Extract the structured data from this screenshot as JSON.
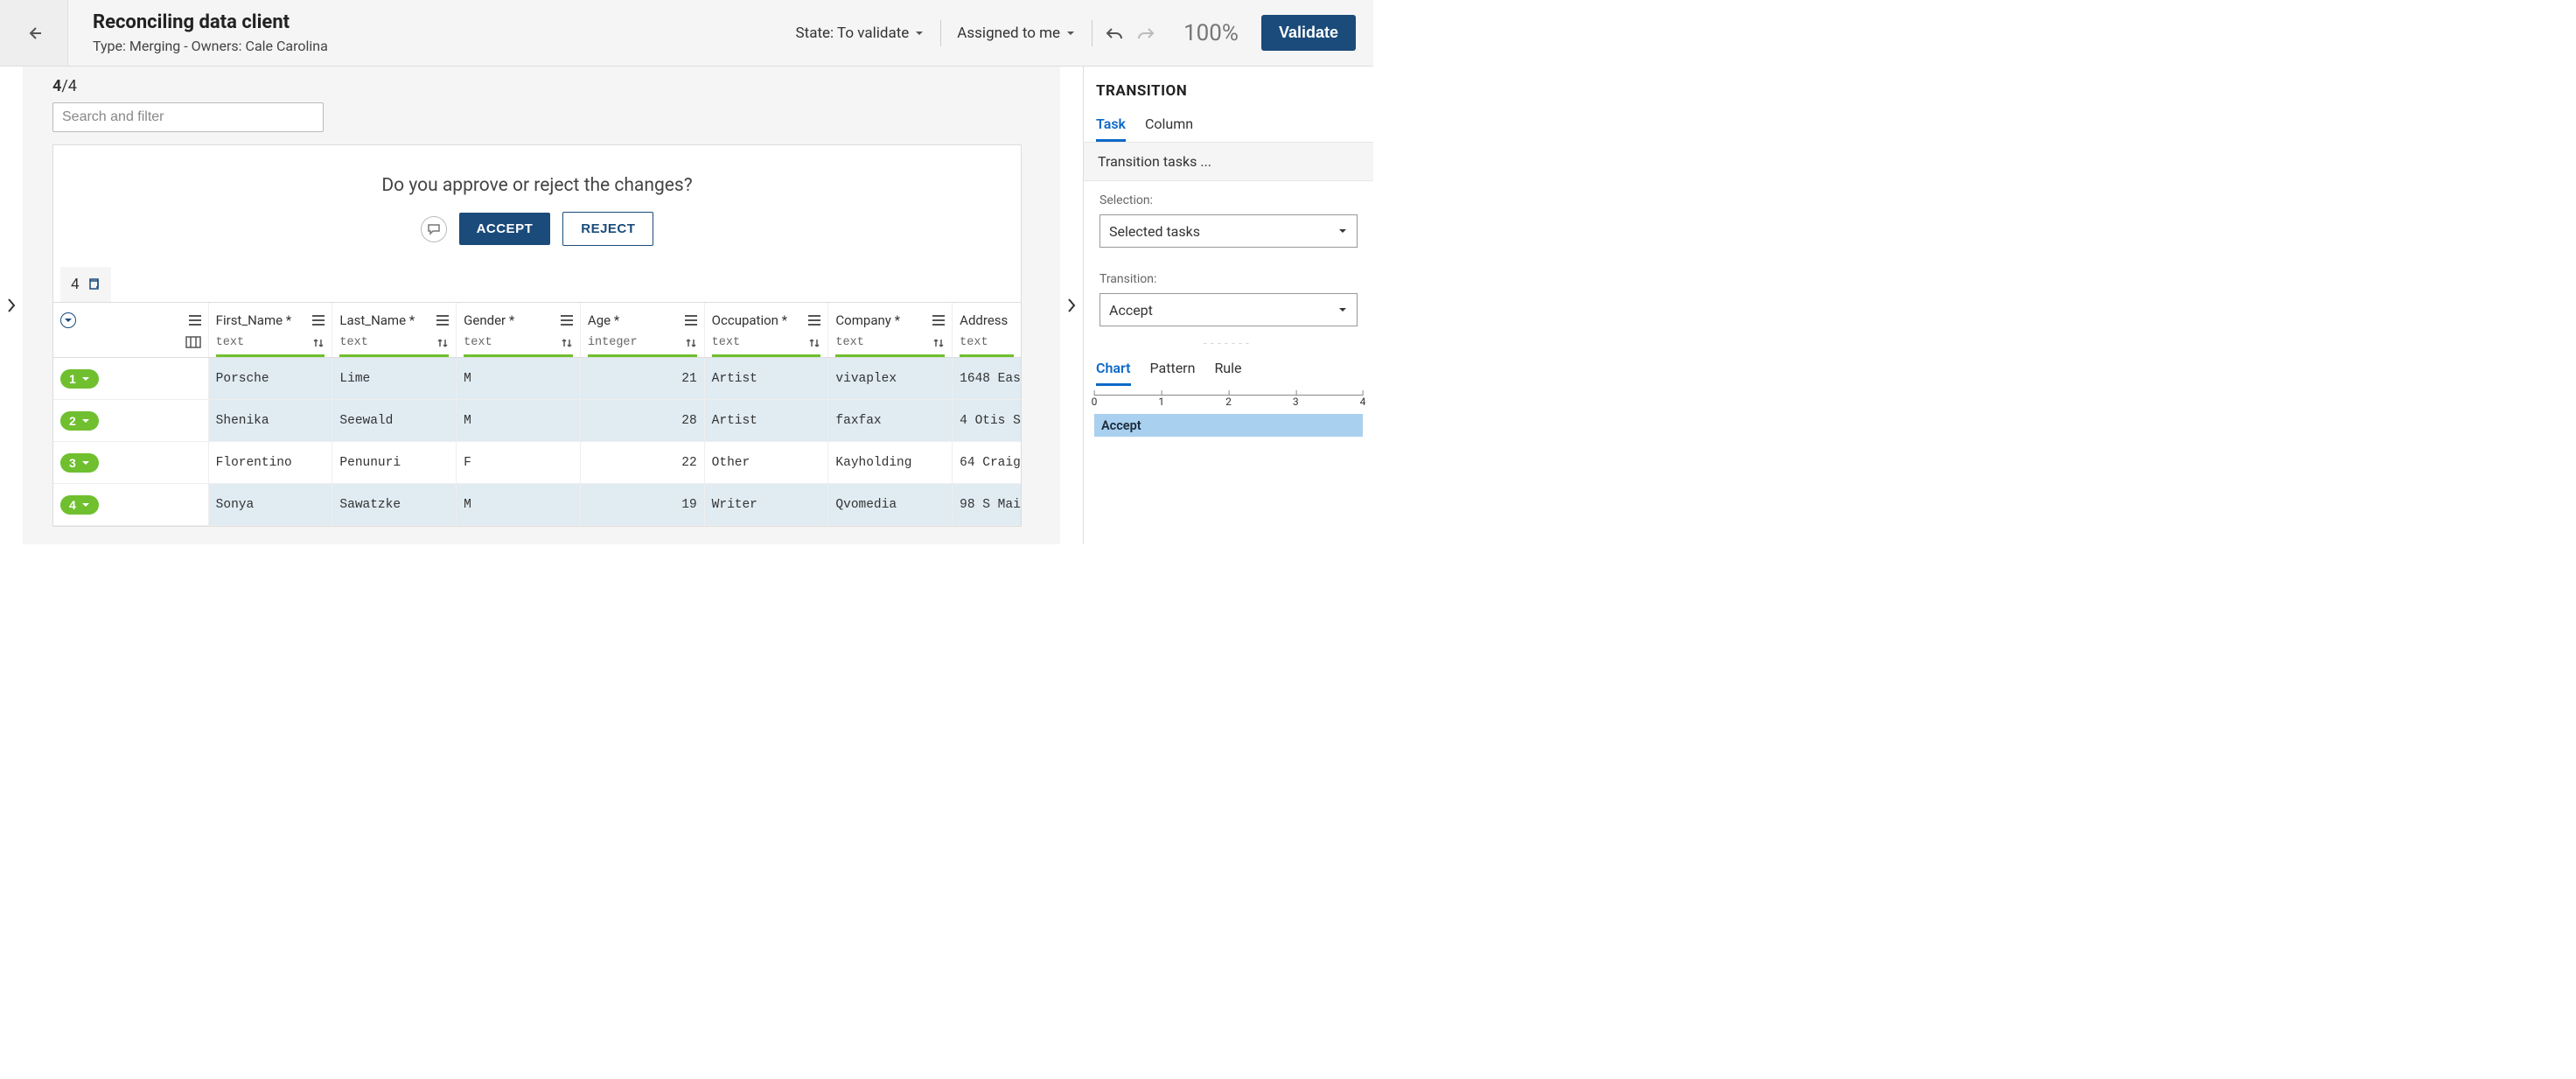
{
  "header": {
    "title": "Reconciling data client",
    "subtitle": "Type: Merging - Owners: Cale Carolina",
    "state_label": "State: To validate",
    "assigned_label": "Assigned to me",
    "zoom": "100%",
    "validate_label": "Validate"
  },
  "center": {
    "counter_current": "4",
    "counter_total": "/4",
    "search_placeholder": "Search and filter",
    "prompt": "Do you approve or reject the changes?",
    "accept_label": "ACCEPT",
    "reject_label": "REJECT",
    "row_count_badge": "4"
  },
  "columns": [
    {
      "label": "First_Name *",
      "type": "text"
    },
    {
      "label": "Last_Name *",
      "type": "text"
    },
    {
      "label": "Gender *",
      "type": "text"
    },
    {
      "label": "Age *",
      "type": "integer"
    },
    {
      "label": "Occupation *",
      "type": "text"
    },
    {
      "label": "Company *",
      "type": "text"
    },
    {
      "label": "Address",
      "type": "text"
    }
  ],
  "rows": [
    {
      "n": "1",
      "sel": true,
      "first": "Porsche",
      "last": "Lime",
      "gender": "M",
      "age": "21",
      "occ": "Artist",
      "comp": "vivaplex",
      "addr": "1648 Eas"
    },
    {
      "n": "2",
      "sel": true,
      "first": "Shenika",
      "last": "Seewald",
      "gender": "M",
      "age": "28",
      "occ": "Artist",
      "comp": "faxfax",
      "addr": "4 Otis S"
    },
    {
      "n": "3",
      "sel": false,
      "first": "Florentino",
      "last": "Penunuri",
      "gender": "F",
      "age": "22",
      "occ": "Other",
      "comp": "Kayholding",
      "addr": "64 Craig"
    },
    {
      "n": "4",
      "sel": true,
      "first": "Sonya",
      "last": "Sawatzke",
      "gender": "M",
      "age": "19",
      "occ": "Writer",
      "comp": "Qvomedia",
      "addr": "98 S Mai"
    }
  ],
  "transition": {
    "header": "TRANSITION",
    "tab_task": "Task",
    "tab_column": "Column",
    "subtitle": "Transition tasks ...",
    "selection_label": "Selection:",
    "selection_value": "Selected tasks",
    "transition_label": "Transition:",
    "transition_value": "Accept",
    "tab_chart": "Chart",
    "tab_pattern": "Pattern",
    "tab_rule": "Rule"
  },
  "chart_data": {
    "type": "bar",
    "orientation": "horizontal",
    "categories": [
      "Accept"
    ],
    "values": [
      4
    ],
    "x_ticks": [
      0,
      1,
      2,
      3,
      4
    ],
    "xlim": [
      0,
      4
    ]
  }
}
